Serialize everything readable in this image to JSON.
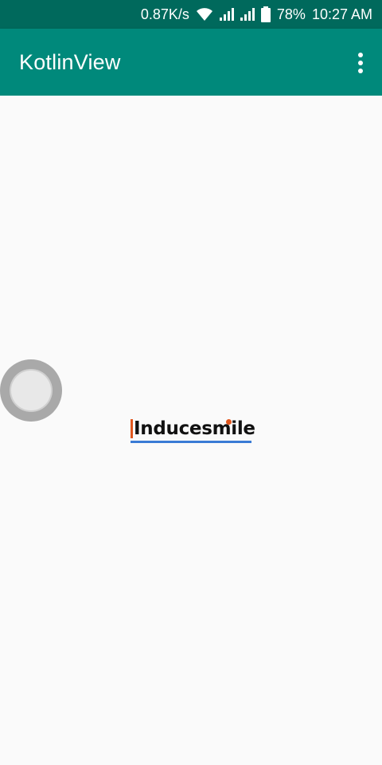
{
  "status_bar": {
    "speed": "0.87K/s",
    "battery": "78%",
    "time": "10:27 AM"
  },
  "app_bar": {
    "title": "KotlinView",
    "overflow_icon": "more-vert-icon"
  },
  "content": {
    "brand_text": "Inducesmile"
  },
  "colors": {
    "status_bar": "#00695c",
    "app_bar": "#00897b",
    "background": "#fafafa",
    "brand_accent": "#e2571e",
    "brand_underline": "#3a7bd5"
  }
}
